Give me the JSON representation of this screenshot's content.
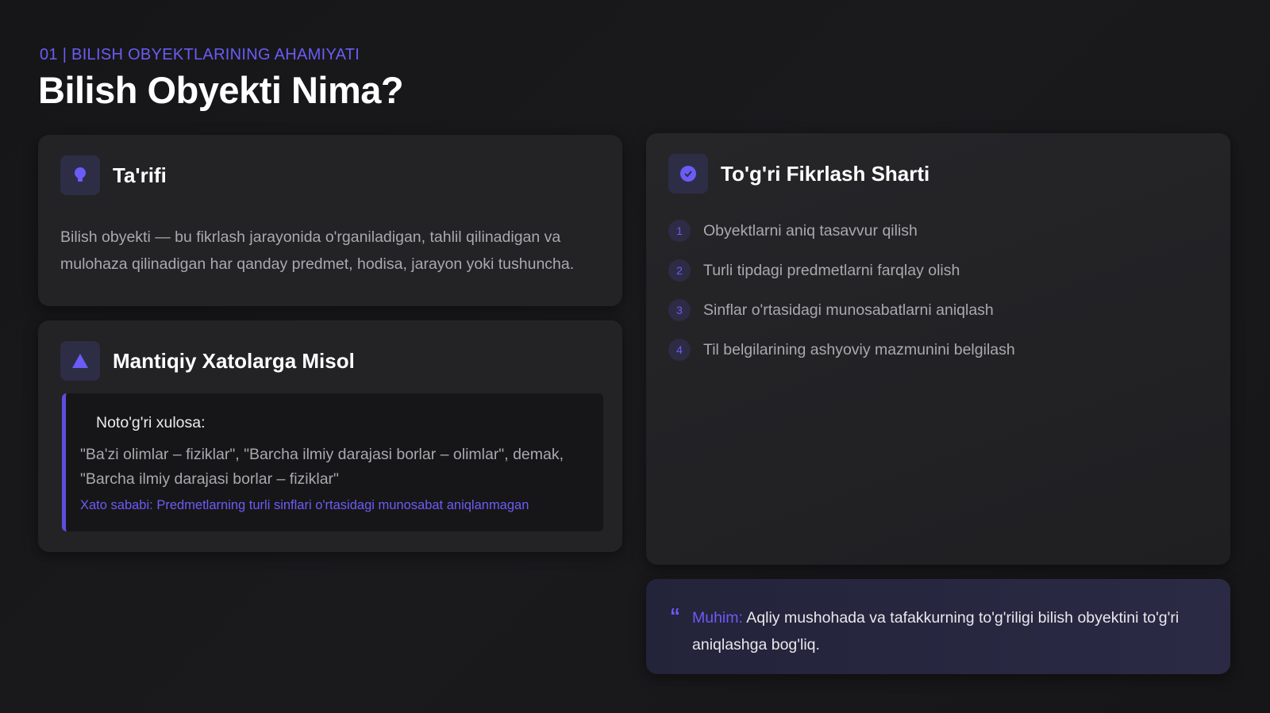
{
  "header": {
    "section_label": "01 | BILISH OBYEKTLARINING AHAMIYATI",
    "title": "Bilish Obyekti Nima?"
  },
  "definition_card": {
    "icon": "lightbulb-icon",
    "title": "Ta'rifi",
    "text": "Bilish obyekti — bu fikrlash jarayonida o'rganiladigan, tahlil qilinadigan va mulohaza qilinadigan har qanday predmet, hodisa, jarayon yoki tushuncha."
  },
  "error_card": {
    "icon": "warning-icon",
    "title": "Mantiqiy Xatolarga Misol",
    "label": "Noto'g'ri xulosa:",
    "quote": "\"Ba'zi olimlar – fiziklar\", \"Barcha ilmiy darajasi borlar – olimlar\", demak, \"Barcha ilmiy darajasi borlar – fiziklar\"",
    "reason": "Xato sababi: Predmetlarning turli sinflari o'rtasidagi munosabat aniqlanmagan"
  },
  "condition_card": {
    "icon": "check-circle-icon",
    "title": "To'g'ri Fikrlash Sharti",
    "items": [
      {
        "num": "1",
        "text": "Obyektlarni aniq tasavvur qilish"
      },
      {
        "num": "2",
        "text": "Turli tipdagi predmetlarni farqlay olish"
      },
      {
        "num": "3",
        "text": "Sinflar o'rtasidagi munosabatlarni aniqlash"
      },
      {
        "num": "4",
        "text": "Til belgilarining ashyoviy mazmunini belgilash"
      }
    ]
  },
  "note_card": {
    "icon": "quote-icon",
    "key": "Muhim:",
    "text": " Aqliy mushohada va tafakkurning to'g'riligi bilish obyektini to'g'ri aniqlashga bog'liq."
  },
  "colors": {
    "accent": "#6b5cf6",
    "background": "#161618",
    "card": "#232326"
  }
}
